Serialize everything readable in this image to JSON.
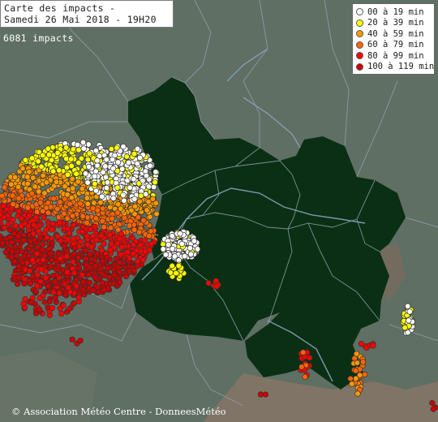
{
  "title": {
    "line1": "Carte des impacts -",
    "line2": "Samedi 26 Mai 2018  - 19H20"
  },
  "impact_count": "6081 impacts",
  "legend": {
    "items": [
      {
        "label": "00 à 19 min",
        "color": "#ffffff"
      },
      {
        "label": "20 à 39 min",
        "color": "#ffff00"
      },
      {
        "label": "40 à 59 min",
        "color": "#ff9900"
      },
      {
        "label": "60 à 79 min",
        "color": "#ff6600"
      },
      {
        "label": "80 à 99 min",
        "color": "#ff0000"
      },
      {
        "label": "100 à 119 min",
        "color": "#cc0000"
      }
    ]
  },
  "copyright": "© Association Météo Centre - DonneesMétéo",
  "colors": {
    "background": "#5f6f64",
    "region": "#0b2f14",
    "border": "#8fa2ae",
    "river": "#8aa2bb",
    "relief": "#9c7a6a"
  }
}
